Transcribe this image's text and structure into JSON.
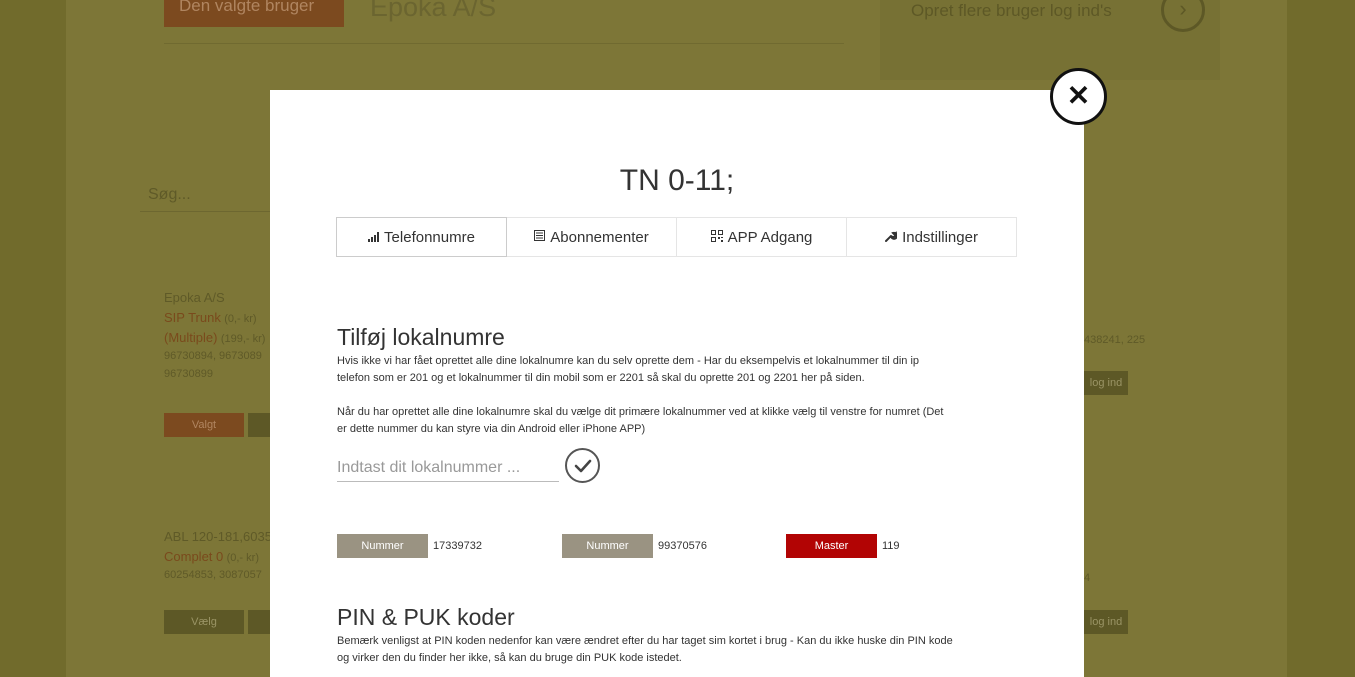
{
  "background": {
    "top_button": "Den valgte bruger",
    "company_title": "Epoka A/S",
    "create_link": "Opret flere bruger log ind's",
    "create_icon": "chevron-right-icon",
    "search_placeholder": "Søg...",
    "card1": {
      "name": "Epoka A/S",
      "line1": "SIP Trunk",
      "line1_price": "(0,- kr)",
      "line2": "(Multiple)",
      "line2_price": "(199,- kr)",
      "numbers1": "96730894, 9673089",
      "numbers2": "96730899",
      "button": "Valgt",
      "right_numbers": "438241, 225",
      "right_button": "log ind"
    },
    "card2": {
      "name": "ABL 120-181,6035",
      "line1": "Complet 0",
      "line1_price": "(0,- kr)",
      "numbers1": "60254853, 3087057",
      "button": "Vælg",
      "right_numbers": "4",
      "right_button": "log ind"
    }
  },
  "modal": {
    "close_icon": "close-icon",
    "title": "TN 0-11;",
    "tabs": [
      {
        "label": "Telefonnumre",
        "icon": "signal-icon",
        "active": true
      },
      {
        "label": "Abonnementer",
        "icon": "list-icon",
        "active": false
      },
      {
        "label": "APP Adgang",
        "icon": "qrcode-icon",
        "active": false
      },
      {
        "label": "Indstillinger",
        "icon": "wrench-icon",
        "active": false
      }
    ],
    "section1": {
      "title": "Tilføj lokalnumre",
      "text1a": "Hvis ikke vi har fået oprettet alle dine lokalnumre kan du selv oprette dem - Har du eksempelvis et lokalnummer til din ip",
      "text1b": "telefon som er 201 og et lokalnummer til din mobil som er 2201 så skal du oprette 201 og 2201 her på siden.",
      "text2a": "Når du har oprettet alle dine lokalnumre skal du vælge dit primære lokalnummer ved at klikke vælg til venstre for numret (Det",
      "text2b": "er dette nummer du kan styre via din Android eller iPhone APP)",
      "input_placeholder": "Indtast dit lokalnummer ...",
      "submit_icon": "checkmark-icon"
    },
    "numbers": [
      {
        "chip": "Nummer",
        "value": "17339732",
        "chip_color": "#9a9382"
      },
      {
        "chip": "Nummer",
        "value": "99370576",
        "chip_color": "#9a9382"
      },
      {
        "chip": "Master",
        "value": "119",
        "chip_color": "#b20404"
      }
    ],
    "section2": {
      "title": "PIN & PUK koder",
      "text1a": "Bemærk venligst at PIN koden nedenfor kan være ændret efter du har taget sim kortet i brug - Kan du ikke huske din PIN kode",
      "text1b": "og virker den du finder her ikke, så kan du bruge din PUK kode istedet."
    }
  }
}
